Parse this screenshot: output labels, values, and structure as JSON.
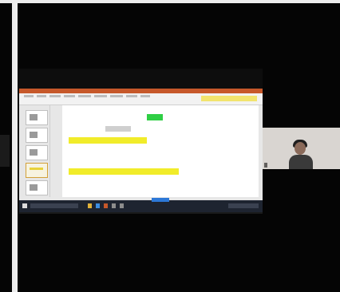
{
  "meeting": {
    "participant_name": "",
    "colors": {
      "ribbon_accent": "#c6582a",
      "highlight": "#f1ec2a",
      "badge_green": "#2fcf45",
      "taskbar": "#1e2430"
    }
  },
  "slide": {
    "number_left": "",
    "number_right": "",
    "badge": "",
    "date_box": "",
    "items": [
      {
        "heading": "",
        "text": ""
      },
      {
        "heading": "",
        "text": ""
      }
    ]
  },
  "icons": [
    "windows-logo-icon",
    "search-box-icon",
    "file-explorer-icon",
    "browser-icon",
    "powerpoint-icon",
    "system-tray-icon"
  ]
}
